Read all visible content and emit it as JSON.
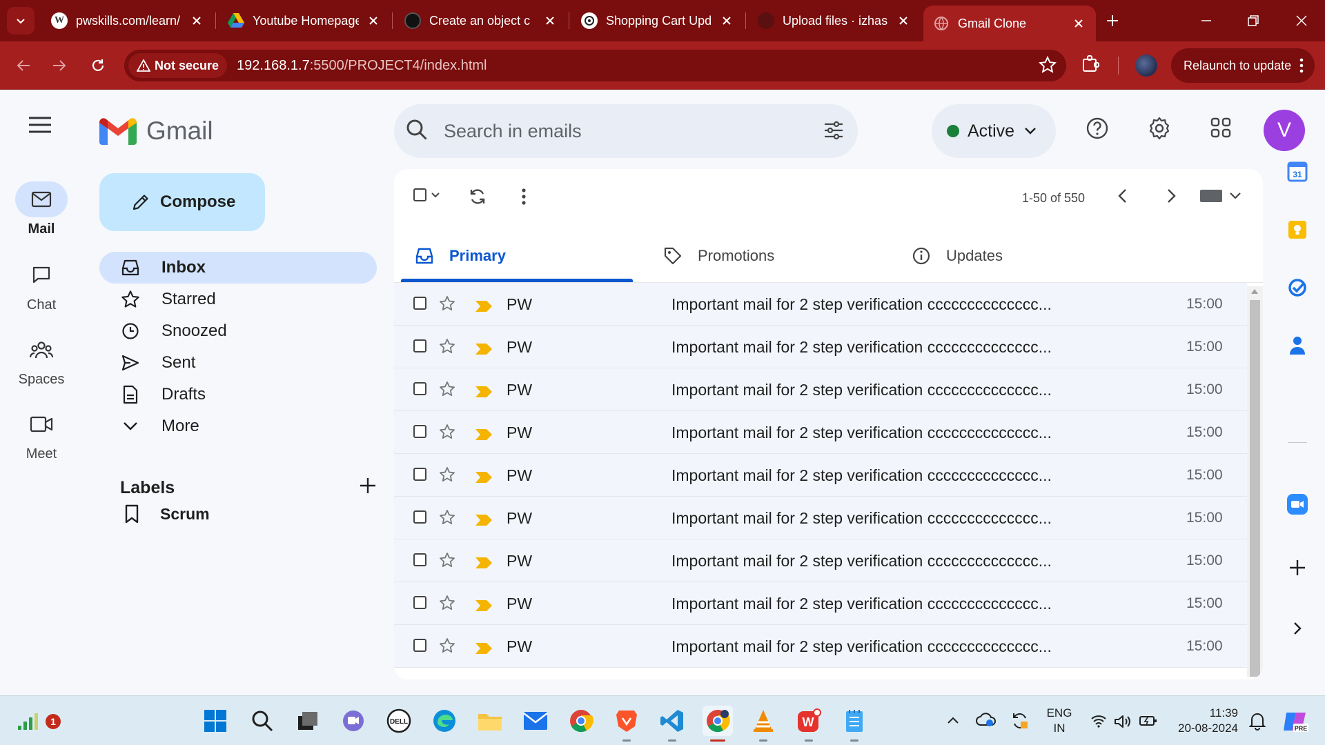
{
  "browser": {
    "tabs": [
      {
        "title": "pwskills.com/learn/",
        "favicon": "wordpress-icon"
      },
      {
        "title": "Youtube Homepage",
        "favicon": "google-drive-icon"
      },
      {
        "title": "Create an object c",
        "favicon": "github-dark-icon"
      },
      {
        "title": "Shopping Cart Upd",
        "favicon": "openai-icon"
      },
      {
        "title": "Upload files · izhas",
        "favicon": "github-icon"
      },
      {
        "title": "Gmail Clone",
        "favicon": "globe-icon"
      }
    ],
    "active_tab": 5,
    "security_label": "Not secure",
    "url_host": "192.168.1.7",
    "url_path": ":5500/PROJECT4/index.html",
    "relaunch_label": "Relaunch to update"
  },
  "rail": {
    "items": [
      {
        "label": "Mail",
        "icon": "mail-icon"
      },
      {
        "label": "Chat",
        "icon": "chat-icon"
      },
      {
        "label": "Spaces",
        "icon": "spaces-icon"
      },
      {
        "label": "Meet",
        "icon": "video-icon"
      }
    ]
  },
  "app": {
    "name": "Gmail",
    "compose_label": "Compose",
    "search_placeholder": "Search in emails",
    "status_label": "Active",
    "avatar_initial": "V"
  },
  "nav": {
    "items": [
      {
        "label": "Inbox",
        "icon": "inbox-icon"
      },
      {
        "label": "Starred",
        "icon": "star-icon"
      },
      {
        "label": "Snoozed",
        "icon": "clock-icon"
      },
      {
        "label": "Sent",
        "icon": "send-icon"
      },
      {
        "label": "Drafts",
        "icon": "draft-icon"
      },
      {
        "label": "More",
        "icon": "chevron-down-icon"
      }
    ],
    "labels_title": "Labels",
    "labels": [
      {
        "label": "Scrum",
        "icon": "bookmark-icon"
      }
    ]
  },
  "toolbar": {
    "pagination": "1-50 of 550"
  },
  "inbox_tabs": [
    {
      "label": "Primary",
      "icon": "inbox-tab-icon"
    },
    {
      "label": "Promotions",
      "icon": "tag-icon"
    },
    {
      "label": "Updates",
      "icon": "info-icon"
    }
  ],
  "emails": [
    {
      "sender": "PW",
      "subject": "Important mail for 2 step verification cccccccccccccc...",
      "time": "15:00"
    },
    {
      "sender": "PW",
      "subject": "Important mail for 2 step verification cccccccccccccc...",
      "time": "15:00"
    },
    {
      "sender": "PW",
      "subject": "Important mail for 2 step verification cccccccccccccc...",
      "time": "15:00"
    },
    {
      "sender": "PW",
      "subject": "Important mail for 2 step verification cccccccccccccc...",
      "time": "15:00"
    },
    {
      "sender": "PW",
      "subject": "Important mail for 2 step verification cccccccccccccc...",
      "time": "15:00"
    },
    {
      "sender": "PW",
      "subject": "Important mail for 2 step verification cccccccccccccc...",
      "time": "15:00"
    },
    {
      "sender": "PW",
      "subject": "Important mail for 2 step verification cccccccccccccc...",
      "time": "15:00"
    },
    {
      "sender": "PW",
      "subject": "Important mail for 2 step verification cccccccccccccc...",
      "time": "15:00"
    },
    {
      "sender": "PW",
      "subject": "Important mail for 2 step verification cccccccccccccc...",
      "time": "15:00"
    }
  ],
  "side_panel": {
    "calendar_day": "31",
    "icons": [
      "calendar-icon",
      "keep-icon",
      "tasks-icon",
      "contacts-icon",
      "zoom-icon",
      "add-icon",
      "expand-icon"
    ]
  },
  "taskbar": {
    "notification_count": "1",
    "lang_line1": "ENG",
    "lang_line2": "IN",
    "clock_time": "11:39",
    "clock_date": "20-08-2024",
    "pre_badge": "PRE"
  },
  "colors": {
    "chrome_dark": "#7a0d0d",
    "chrome_toolbar": "#a61f1f",
    "compose_bg": "#c2e7ff",
    "active_nav_bg": "#d3e3fd",
    "primary_blue": "#0b57d0",
    "status_green": "#188038",
    "avatar_purple": "#9c3fe0"
  }
}
